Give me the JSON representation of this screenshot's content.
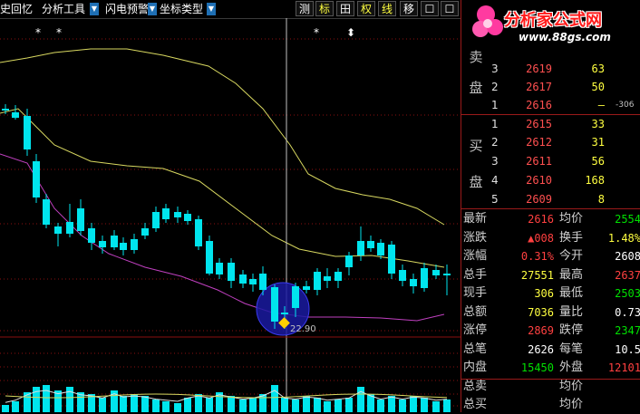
{
  "toolbar": {
    "items": [
      "史回忆",
      "分析工具",
      "闪电预警",
      "坐标类型"
    ],
    "buttons": [
      "测",
      "标",
      "田",
      "权",
      "线",
      "移",
      "☐",
      "☐"
    ]
  },
  "logo": {
    "title": "分析家公式网",
    "url": "www.88gs.com"
  },
  "chart": {
    "stars": [
      "*",
      "*",
      "*",
      "⬍"
    ],
    "low_label": "22.90",
    "colors": {
      "up": "#ff4040",
      "down": "#00e5ee",
      "ma_upper": "#d8d860",
      "ma_lower": "#c040c0",
      "grid": "#8a1010"
    }
  },
  "orderbook": {
    "sell_label": [
      "卖",
      "盘"
    ],
    "buy_label": [
      "买",
      "盘"
    ],
    "sell": [
      {
        "level": "3",
        "price": "2619",
        "volume": "63"
      },
      {
        "level": "2",
        "price": "2617",
        "volume": "50"
      },
      {
        "level": "1",
        "price": "2616",
        "volume": "–",
        "extra": "-306"
      }
    ],
    "buy": [
      {
        "level": "1",
        "price": "2615",
        "volume": "33"
      },
      {
        "level": "2",
        "price": "2612",
        "volume": "31"
      },
      {
        "level": "3",
        "price": "2611",
        "volume": "56"
      },
      {
        "level": "4",
        "price": "2610",
        "volume": "168"
      },
      {
        "level": "5",
        "price": "2609",
        "volume": "8"
      }
    ]
  },
  "stats": [
    {
      "l1": "最新",
      "v1": "2616",
      "c1": "#ff4040",
      "l2": "均价",
      "v2": "2554",
      "c2": "#00e000"
    },
    {
      "l1": "涨跌",
      "v1": "▲008",
      "c1": "#ff4040",
      "l2": "换手",
      "v2": "1.48%",
      "c2": "#ffff40"
    },
    {
      "l1": "涨幅",
      "v1": "0.31%",
      "c1": "#ff4040",
      "l2": "今开",
      "v2": "2608",
      "c2": "#ffffff"
    },
    {
      "l1": "总手",
      "v1": "27551",
      "c1": "#ffff40",
      "l2": "最高",
      "v2": "2637",
      "c2": "#ff4040"
    },
    {
      "l1": "现手",
      "v1": "306",
      "c1": "#ffff40",
      "l2": "最低",
      "v2": "2503",
      "c2": "#00e000"
    },
    {
      "l1": "总额",
      "v1": "7036",
      "c1": "#ffff40",
      "l2": "量比",
      "v2": "0.73",
      "c2": "#ffffff"
    },
    {
      "l1": "涨停",
      "v1": "2869",
      "c1": "#ff4040",
      "l2": "跌停",
      "v2": "2347",
      "c2": "#00e000"
    },
    {
      "l1": "总笔",
      "v1": "2626",
      "c1": "#ffffff",
      "l2": "每笔",
      "v2": "10.5",
      "c2": "#ffffff"
    },
    {
      "l1": "内盘",
      "v1": "15450",
      "c1": "#00e000",
      "l2": "外盘",
      "v2": "12101",
      "c2": "#ff4040"
    },
    {
      "l1": "总卖",
      "v1": "",
      "c1": "#ffffff",
      "l2": "均价",
      "v2": "",
      "c2": "#ffffff"
    },
    {
      "l1": "总买",
      "v1": "",
      "c1": "#ffffff",
      "l2": "均价",
      "v2": "",
      "c2": "#ffffff"
    }
  ]
}
